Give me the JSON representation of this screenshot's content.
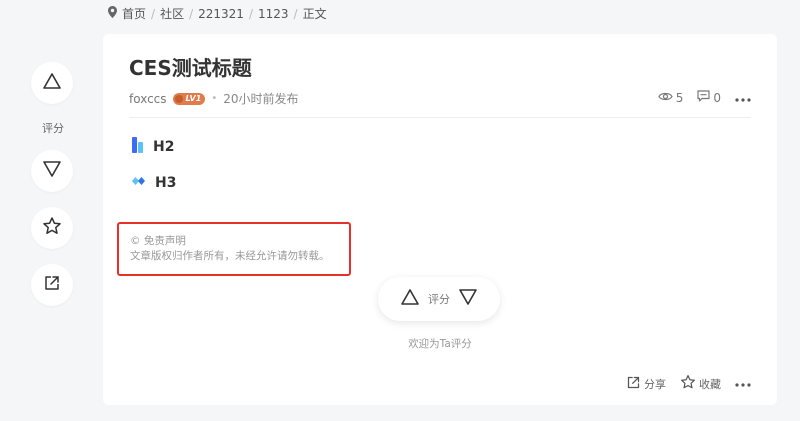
{
  "breadcrumb": {
    "items": [
      "首页",
      "社区",
      "221321",
      "1123",
      "正文"
    ]
  },
  "left_rail": {
    "rate_label": "评分"
  },
  "article": {
    "title": "CES测试标题",
    "author": "foxccs",
    "level_badge": "LV1",
    "time": "20小时前发布",
    "views": "5",
    "comments": "0",
    "headings": [
      "H2",
      "H3"
    ],
    "disclaimer_title": "© 免责声明",
    "disclaimer_text": "文章版权归作者所有，未经允许请勿转载。"
  },
  "rating": {
    "label": "评分",
    "welcome": "欢迎为Ta评分"
  },
  "footer": {
    "share_label": "分享",
    "favorite_label": "收藏"
  },
  "colors": {
    "highlight_border": "#e8302a",
    "badge": "#e07b4a",
    "h2_icon": "#3b6cf6",
    "h3_icon": "#2f74e6"
  }
}
